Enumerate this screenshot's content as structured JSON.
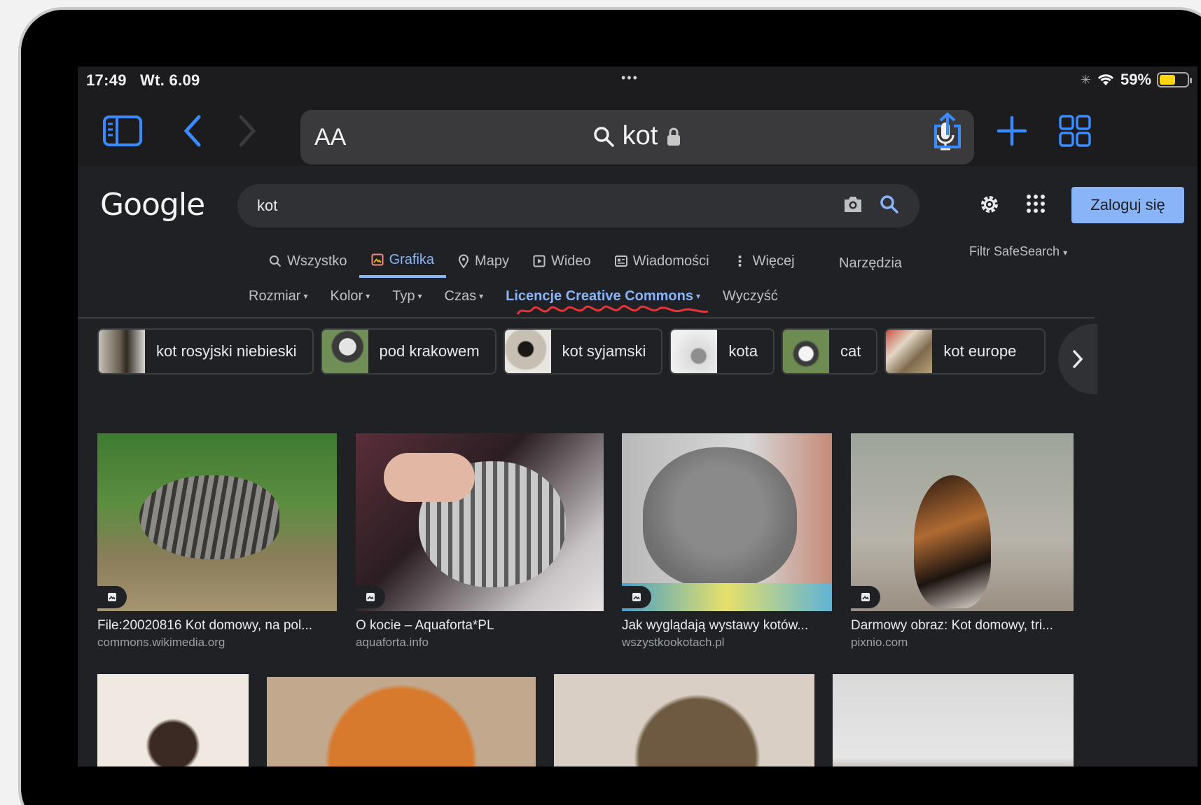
{
  "status_bar": {
    "time": "17:49",
    "date": "Wt. 6.09",
    "battery": "59%",
    "battery_level": 0.59
  },
  "browser": {
    "reader_label": "AA",
    "address": "kot",
    "icons": [
      "sidebar-icon",
      "back-icon",
      "forward-icon",
      "search-icon",
      "lock-icon",
      "microphone-icon",
      "share-icon",
      "new-tab-icon",
      "tabs-overview-icon"
    ]
  },
  "google": {
    "logo": "Google",
    "query": "kot",
    "sign_in": "Zaloguj się",
    "tabs": [
      {
        "label": "Wszystko",
        "icon": "search-icon"
      },
      {
        "label": "Grafika",
        "icon": "image-icon",
        "active": true
      },
      {
        "label": "Mapy",
        "icon": "map-pin-icon"
      },
      {
        "label": "Wideo",
        "icon": "play-icon"
      },
      {
        "label": "Wiadomości",
        "icon": "news-icon"
      },
      {
        "label": "Więcej",
        "icon": "more-vert-icon"
      }
    ],
    "tools": "Narzędzia",
    "safesearch": "Filtr SafeSearch",
    "filters": [
      {
        "label": "Rozmiar"
      },
      {
        "label": "Kolor"
      },
      {
        "label": "Typ"
      },
      {
        "label": "Czas"
      },
      {
        "label": "Licencje Creative Commons",
        "active": true
      },
      {
        "label": "Wyczyść"
      }
    ],
    "chips": [
      {
        "label": "kot rosyjski niebieski"
      },
      {
        "label": "pod krakowem"
      },
      {
        "label": "kot syjamski"
      },
      {
        "label": "kota"
      },
      {
        "label": "cat"
      },
      {
        "label": "kot europe"
      }
    ],
    "results": [
      {
        "title": "File:20020816 Kot domowy, na pol...",
        "source": "commons.wikimedia.org"
      },
      {
        "title": "O kocie – Aquaforta*PL",
        "source": "aquaforta.info"
      },
      {
        "title": "Jak wyglądają wystawy kotów...",
        "source": "wszystkookotach.pl"
      },
      {
        "title": "Darmowy obraz: Kot domowy, tri...",
        "source": "pixnio.com"
      }
    ]
  }
}
